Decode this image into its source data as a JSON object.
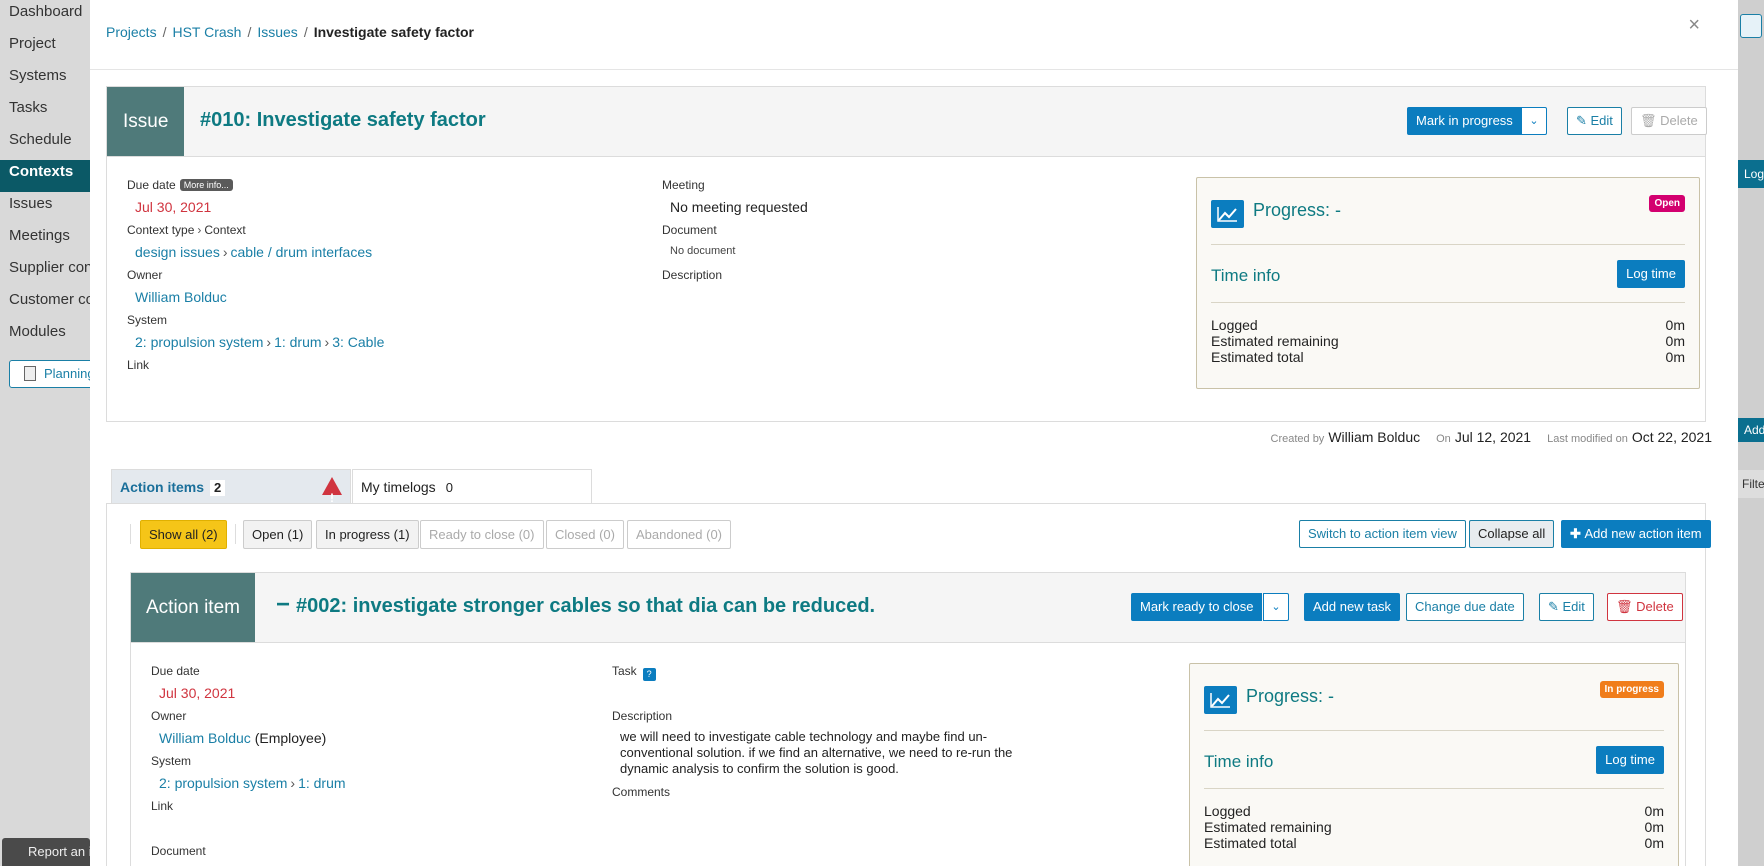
{
  "sidebar": {
    "items": [
      "Dashboard",
      "Project",
      "Systems",
      "Tasks",
      "Schedule",
      "Contexts",
      "Issues",
      "Meetings",
      "Supplier contacts",
      "Customer contacts",
      "Modules"
    ],
    "active_index": 5,
    "planning_label": "Planning",
    "report_label": "Report an issue"
  },
  "right_edge": {
    "b1": "Log",
    "b2": "Add",
    "b3": "Filte"
  },
  "breadcrumb": {
    "projects": "Projects",
    "project": "HST Crash",
    "issues": "Issues",
    "current": "Investigate safety factor",
    "sep": "/"
  },
  "close_label": "×",
  "issue": {
    "type_tag": "Issue",
    "title": "#010: Investigate safety factor",
    "mark_in_progress": "Mark in progress",
    "edit": "Edit",
    "delete": "Delete",
    "due_date_label": "Due date",
    "more_info": "More info...",
    "due_date": "Jul 30, 2021",
    "context_type_label": "Context type",
    "context_label": "Context",
    "context_type": "design issues",
    "context": "cable / drum interfaces",
    "owner_label": "Owner",
    "owner": "William Bolduc",
    "system_label": "System",
    "system_path": [
      "2: propulsion system",
      "1: drum",
      "3: Cable"
    ],
    "link_label": "Link",
    "meeting_label": "Meeting",
    "meeting": "No meeting requested",
    "document_label": "Document",
    "document": "No document",
    "description_label": "Description",
    "progress_title": "Progress: -",
    "status": "Open",
    "status_color": "#d3006f",
    "time_info": "Time info",
    "log_time": "Log time",
    "logged_label": "Logged",
    "logged": "0m",
    "est_remaining_label": "Estimated remaining",
    "est_remaining": "0m",
    "est_total_label": "Estimated total",
    "est_total": "0m"
  },
  "meta": {
    "created_by_label": "Created by",
    "created_by": "William Bolduc",
    "on_label": "On",
    "created_on": "Jul 12, 2021",
    "modified_label": "Last modified on",
    "modified_on": "Oct 22, 2021"
  },
  "tabs": {
    "action_items": "Action items",
    "action_items_count": "2",
    "timelogs": "My timelogs",
    "timelogs_count": "0"
  },
  "filters": {
    "show_all": "Show all (2)",
    "open": "Open (1)",
    "in_progress": "In progress (1)",
    "ready": "Ready to close (0)",
    "closed": "Closed (0)",
    "abandoned": "Abandoned (0)",
    "switch_view": "Switch to action item view",
    "collapse_all": "Collapse all",
    "add_new": "Add new action item"
  },
  "action_item": {
    "type_tag": "Action item",
    "title": "#002: investigate stronger cables so that dia can be reduced.",
    "mark_ready": "Mark ready to close",
    "add_task": "Add new task",
    "change_due": "Change due date",
    "edit": "Edit",
    "delete": "Delete",
    "due_date_label": "Due date",
    "due_date": "Jul 30, 2021",
    "owner_label": "Owner",
    "owner": "William Bolduc",
    "owner_role": "(Employee)",
    "system_label": "System",
    "system_path": [
      "2: propulsion system",
      "1: drum"
    ],
    "link_label": "Link",
    "document_label": "Document",
    "task_label": "Task",
    "task_help": "?",
    "description_label": "Description",
    "description_lines": [
      "we will need to investigate cable technology and maybe find un-",
      "conventional solution. if we find an alternative, we need to re-run the",
      "dynamic analysis to confirm the solution is good."
    ],
    "comments_label": "Comments",
    "progress_title": "Progress: -",
    "status": "In progress",
    "status_color": "#f07d1a",
    "time_info": "Time info",
    "log_time": "Log time",
    "logged_label": "Logged",
    "logged": "0m",
    "est_remaining_label": "Estimated remaining",
    "est_remaining": "0m",
    "est_total_label": "Estimated total",
    "est_total": "0m"
  }
}
